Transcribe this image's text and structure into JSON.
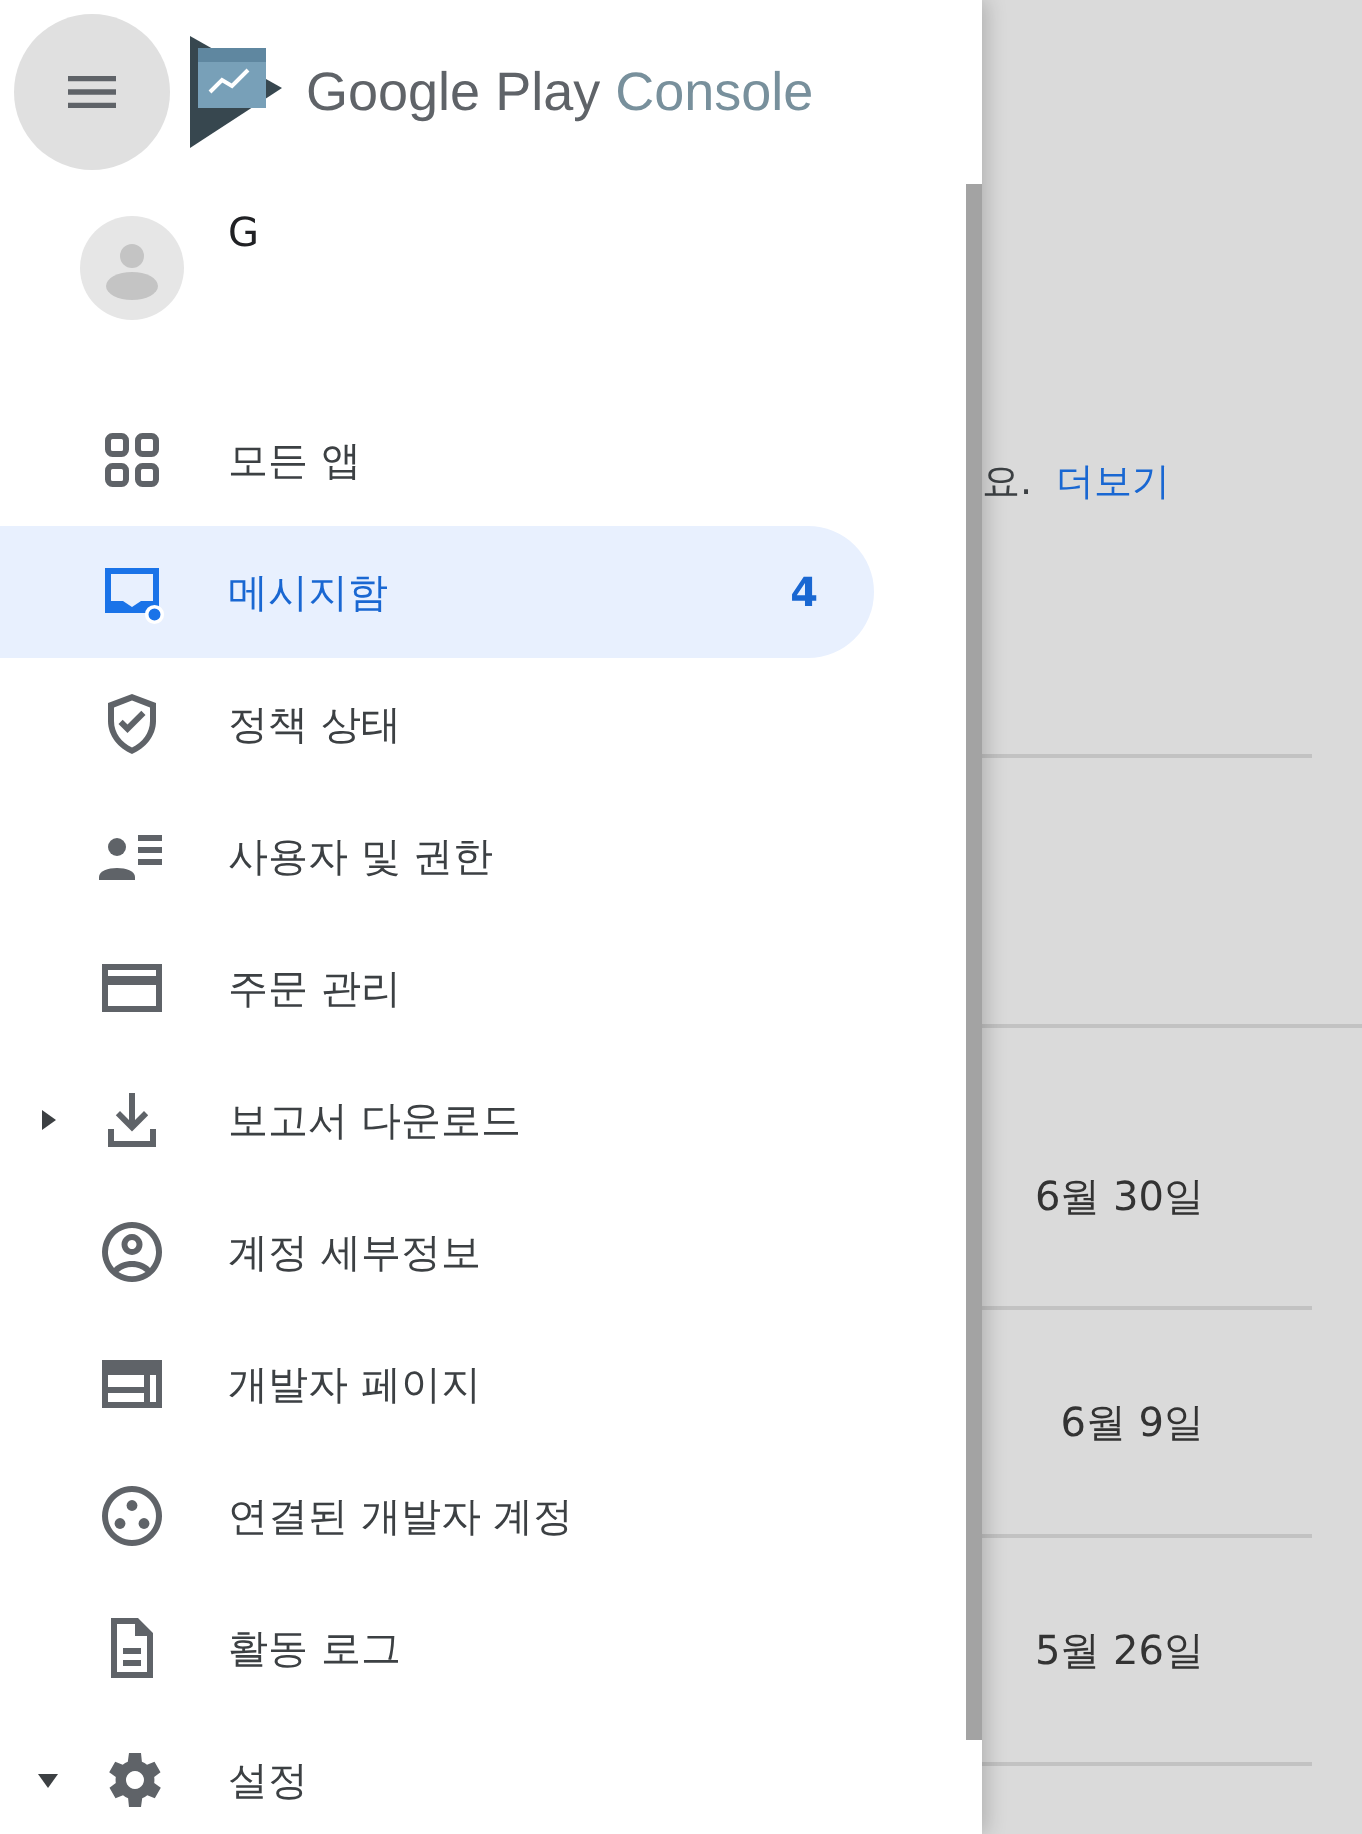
{
  "header": {
    "logo_text": "Google Play",
    "logo_subtext": "Console"
  },
  "account": {
    "initial": "G"
  },
  "nav": [
    {
      "label": "모든 앱",
      "selected": false
    },
    {
      "label": "메시지함",
      "selected": true,
      "badge": "4"
    },
    {
      "label": "정책 상태",
      "selected": false
    },
    {
      "label": "사용자 및 권한",
      "selected": false
    },
    {
      "label": "주문 관리",
      "selected": false
    },
    {
      "label": "보고서 다운로드",
      "selected": false,
      "expanded": false
    },
    {
      "label": "계정 세부정보",
      "selected": false
    },
    {
      "label": "개발자 페이지",
      "selected": false
    },
    {
      "label": "연결된 개발자 계정",
      "selected": false
    },
    {
      "label": "활동 로그",
      "selected": false
    },
    {
      "label": "설정",
      "selected": false,
      "expanded": true
    }
  ],
  "background": {
    "notice_text": "요.",
    "notice_link": "더보기",
    "dates": [
      "6월 30일",
      "6월 9일",
      "5월 26일"
    ]
  }
}
